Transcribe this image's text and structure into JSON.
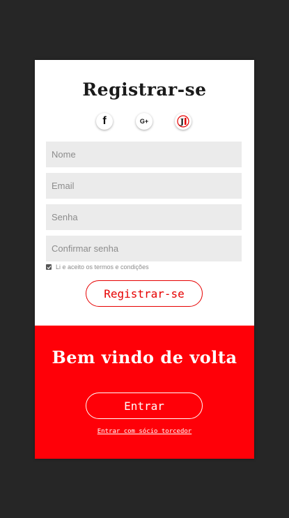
{
  "register": {
    "title": "Registrar-se",
    "social": [
      {
        "icon": "facebook-icon",
        "glyph": "f"
      },
      {
        "icon": "google-plus-icon",
        "glyph": "G+"
      },
      {
        "icon": "club-logo-icon",
        "glyph": "J"
      }
    ],
    "fields": {
      "name_placeholder": "Nome",
      "email_placeholder": "Email",
      "password_placeholder": "Senha",
      "confirm_placeholder": "Confirmar senha"
    },
    "terms_label": "Li e aceito os termos e condições",
    "terms_checked": true,
    "submit_label": "Registrar-se"
  },
  "login": {
    "welcome": "Bem vindo de volta",
    "submit_label": "Entrar",
    "member_link": "Entrar com sócio torcedor"
  },
  "colors": {
    "accent": "#ff0008",
    "background": "#262626",
    "field": "#ebebeb"
  }
}
